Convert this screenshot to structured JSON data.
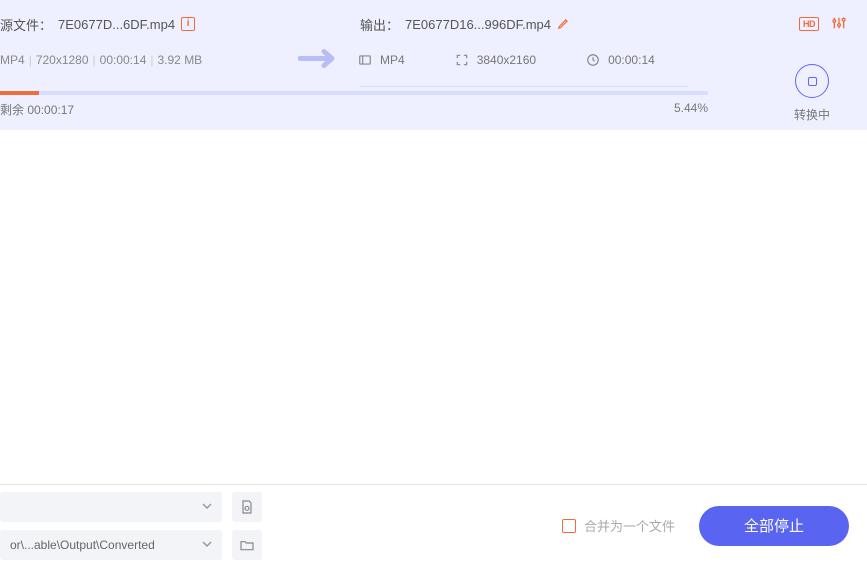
{
  "item": {
    "source": {
      "label": "源文件：",
      "filename": "7E0677D...6DF.mp4",
      "format": "MP4",
      "resolution": "720x1280",
      "duration": "00:00:14",
      "size": "3.92 MB"
    },
    "output": {
      "label": "输出：",
      "filename": "7E0677D16...996DF.mp4",
      "format": "MP4",
      "resolution": "3840x2160",
      "duration": "00:00:14"
    },
    "progress": {
      "remaining_label": "剩余",
      "remaining_time": "00:00:17",
      "percent": "5.44%"
    },
    "status": "转换中",
    "hd_badge": "HD"
  },
  "bottom": {
    "output_path": "or\\...able\\Output\\Converted",
    "merge_label": "合并为一个文件",
    "stop_all": "全部停止"
  }
}
